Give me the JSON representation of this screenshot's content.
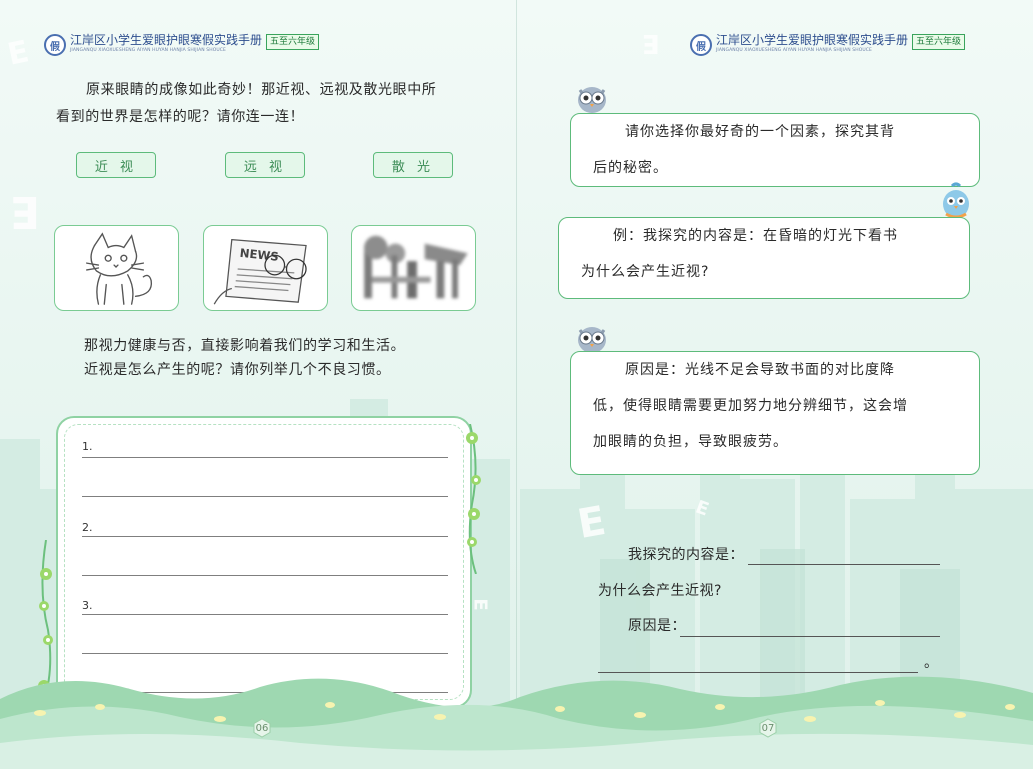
{
  "header": {
    "title": "江岸区小学生爱眼护眼寒假实践手册",
    "subtitle": "JIANGANQU XIAOXUESHENG AIYAN HUYAN HANJIA SHIJIAN SHOUCE",
    "badge": "五至六年级",
    "logo_char": "假"
  },
  "left_page": {
    "intro_line1": "原来眼睛的成像如此奇妙！那近视、远视及散光眼中所",
    "intro_line2": "看到的世界是怎样的呢？请你连一连！",
    "tags": [
      "近 视",
      "远 视",
      "散 光"
    ],
    "images": [
      "cat-drawing",
      "newspaper-with-glasses",
      "blurry-scene"
    ],
    "question_line1": "那视力健康与否，直接影响着我们的学习和生活。",
    "question_line2": "近视是怎么产生的呢？请你列举几个不良习惯。",
    "list_labels": [
      "1.",
      "2.",
      "3.",
      "……"
    ],
    "page_number": "06"
  },
  "right_page": {
    "bubble1_line1": "请你选择你最好奇的一个因素，探究其背",
    "bubble1_line2": "后的秘密。",
    "bubble2_line1": "例：我探究的内容是：在昏暗的灯光下看书",
    "bubble2_line2": "为什么会产生近视?",
    "bubble3_line1": "原因是：光线不足会导致书面的对比度降",
    "bubble3_line2": "低，使得眼睛需要更加努力地分辨细节，这会增",
    "bubble3_line3": "加眼睛的负担，导致眼疲劳。",
    "fill_content_label": "我探究的内容是：",
    "fill_why": "为什么会产生近视?",
    "fill_reason_label": "原因是：",
    "fill_end": "。",
    "page_number": "07"
  },
  "colors": {
    "accent_green": "#5dbb7b",
    "header_blue": "#2d4e8e",
    "background": "#eef7f3"
  }
}
